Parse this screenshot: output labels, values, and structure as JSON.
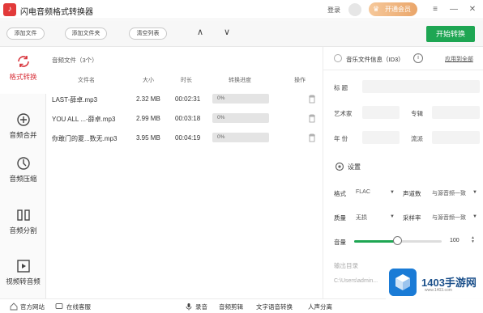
{
  "app": {
    "logo_glyph": "♪",
    "title": "闪电音频格式转换器",
    "login": "登录",
    "vip": "开通会员"
  },
  "toolbar": {
    "add_file": "添加文件",
    "add_folder": "添加文件夹",
    "clear_list": "清空列表",
    "up": "∧",
    "down": "∨",
    "start": "开始转换"
  },
  "sidebar": {
    "items": [
      {
        "label": "格式转换",
        "icon": "convert-icon"
      },
      {
        "label": "音频合并",
        "icon": "merge-icon"
      },
      {
        "label": "音频压缩",
        "icon": "compress-icon"
      },
      {
        "label": "音频分割",
        "icon": "split-icon"
      },
      {
        "label": "视频转音频",
        "icon": "video-icon"
      }
    ]
  },
  "list": {
    "count_label": "音频文件（3个）",
    "columns": {
      "name": "文件名",
      "size": "大小",
      "duration": "时长",
      "progress": "转换进度",
      "action": "操作"
    },
    "rows": [
      {
        "name": "LAST-薛卓.mp3",
        "size": "2.32 MB",
        "duration": "00:02:31",
        "progress": "0%"
      },
      {
        "name": "YOU ALL ...-薛卓.mp3",
        "size": "2.99 MB",
        "duration": "00:03:18",
        "progress": "0%"
      },
      {
        "name": "你敢门的夏...数无.mp3",
        "size": "3.95 MB",
        "duration": "00:04:19",
        "progress": "0%"
      }
    ]
  },
  "id3": {
    "title": "音乐文件信息（ID3）",
    "info": "i",
    "apply_all": "应用到全部",
    "fields": {
      "title_label": "标 题",
      "artist_label": "艺术家",
      "album_label": "专辑",
      "year_label": "年 份",
      "genre_label": "流派"
    }
  },
  "settings": {
    "title": "设置",
    "format_label": "格式",
    "format_value": "FLAC",
    "channel_label": "声道数",
    "channel_value": "与源音频一致",
    "quality_label": "质量",
    "quality_value": "无损",
    "samplerate_label": "采样率",
    "samplerate_value": "与源音频一致",
    "volume_label": "音量",
    "volume_value": "100",
    "volume_fraction": 0.5,
    "output_label": "输出目录",
    "output_path": "C:\\Users\\admin..."
  },
  "statusbar": {
    "website": "官方网站",
    "support": "在线客服",
    "record": "录音",
    "edit": "音频剪辑",
    "tts": "文字语音转换",
    "separate": "人声分离"
  },
  "watermark": {
    "text": "1403手游网",
    "sub": "www.1403.com"
  },
  "colors": {
    "accent_red": "#d8323a",
    "accent_green": "#1ea653"
  }
}
